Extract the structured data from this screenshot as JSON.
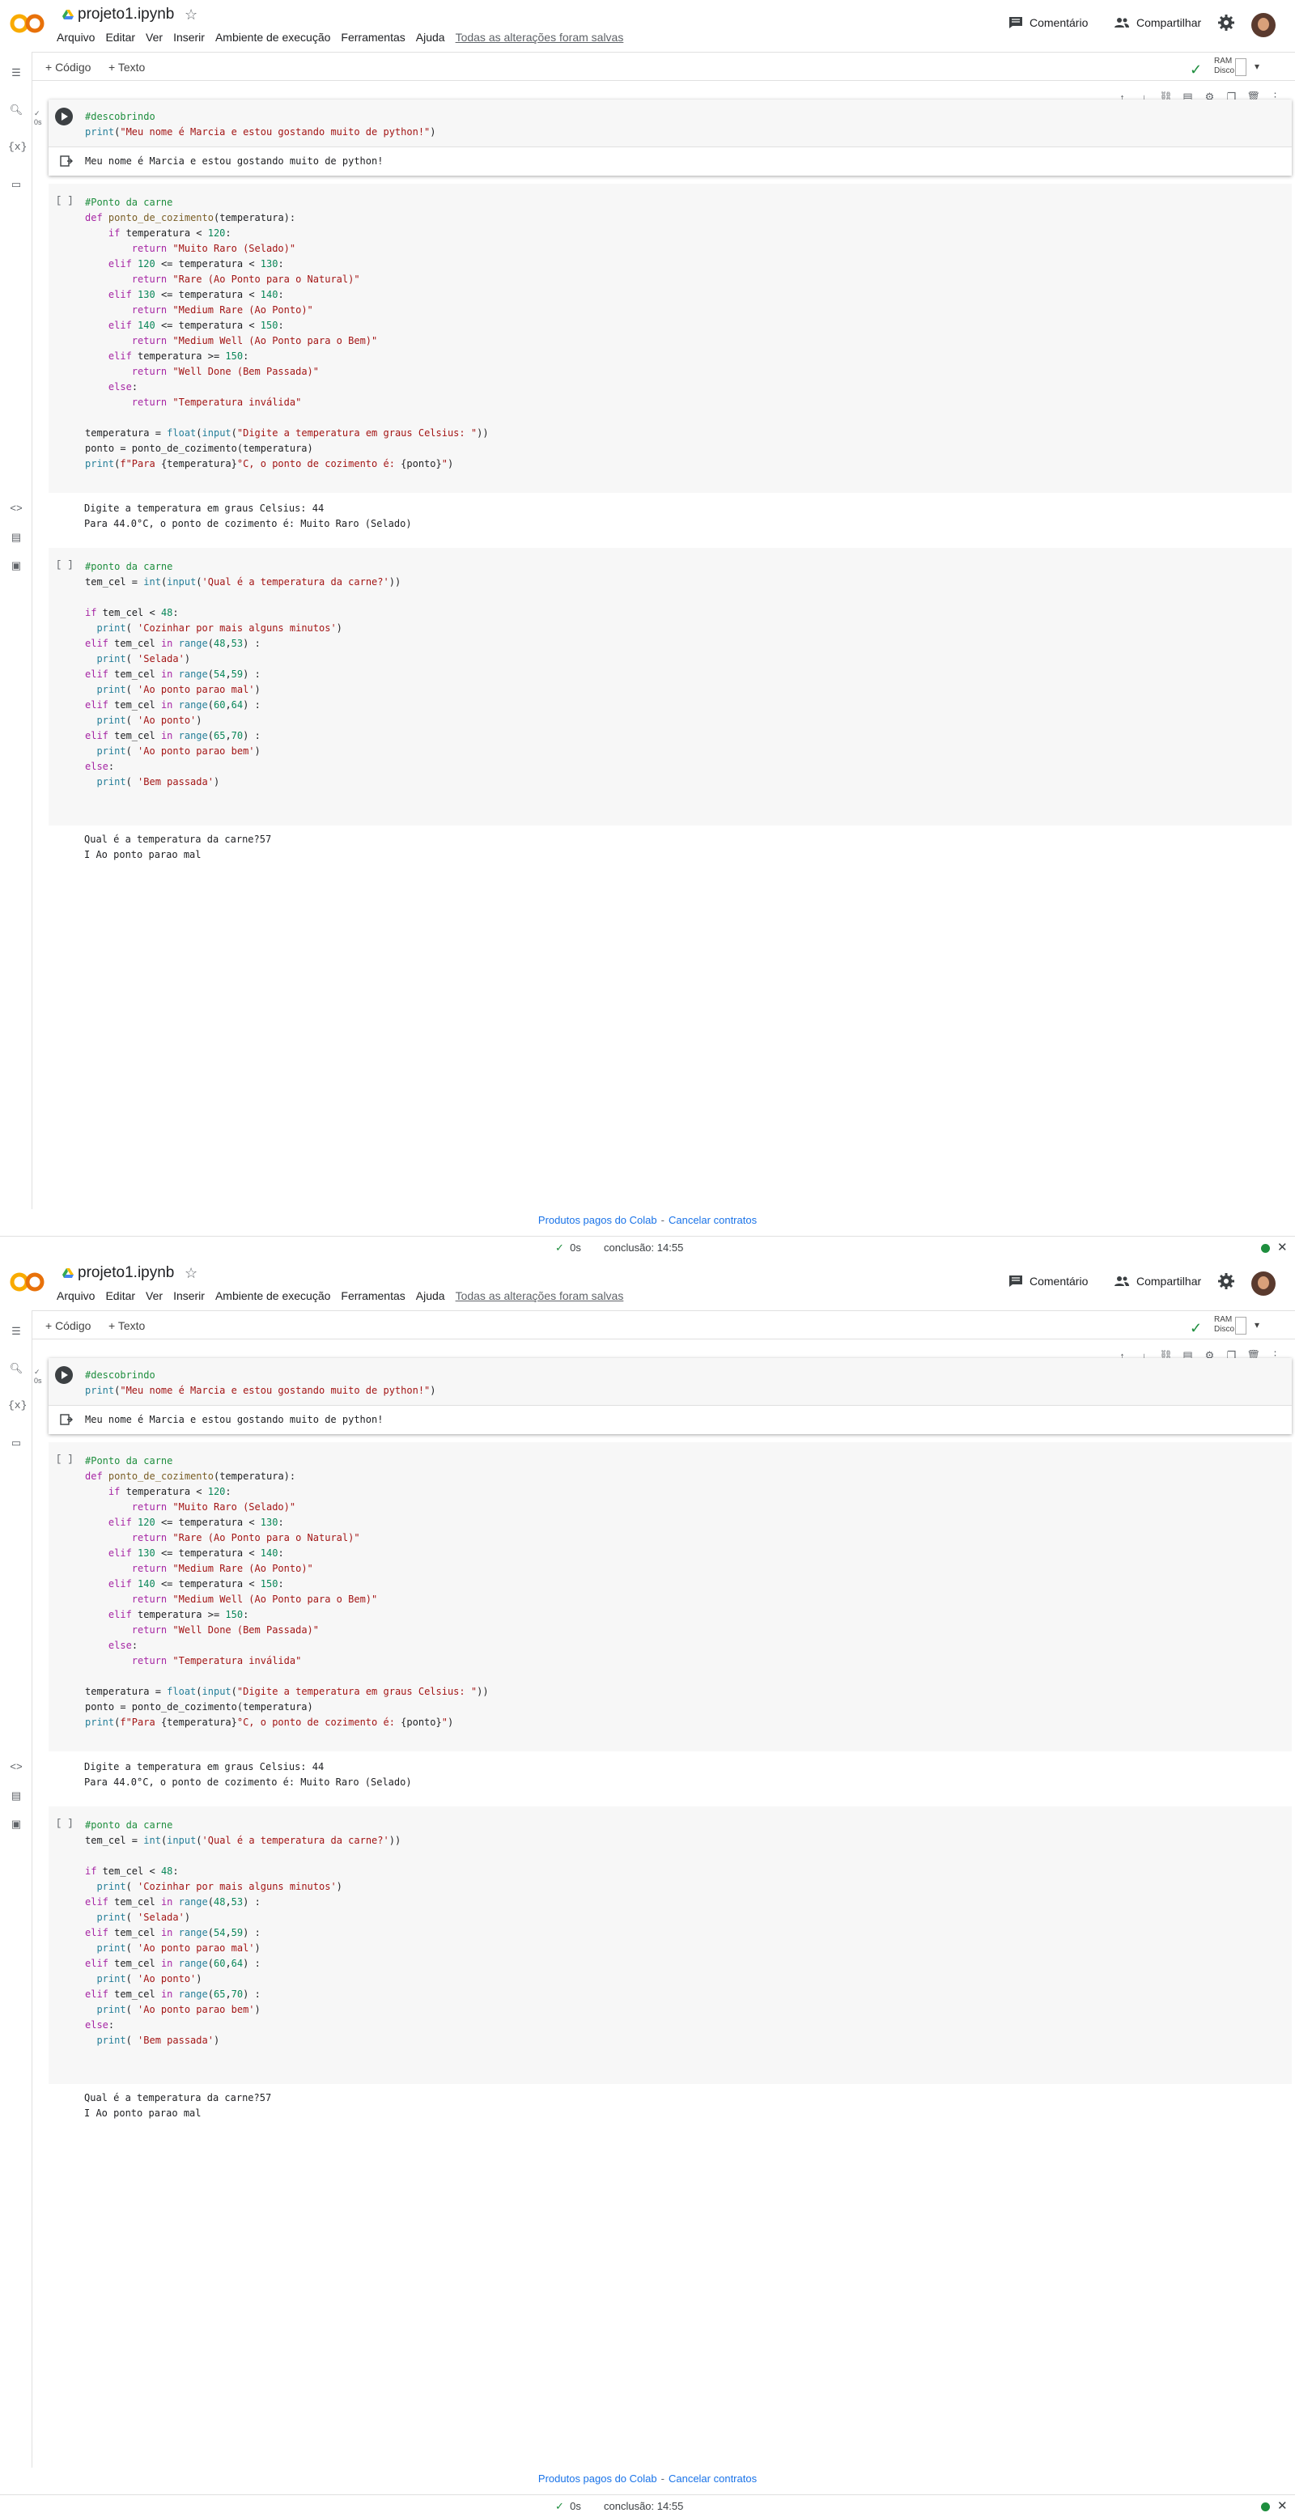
{
  "title": "projeto1.ipynb",
  "menu": [
    "Arquivo",
    "Editar",
    "Ver",
    "Inserir",
    "Ambiente de execução",
    "Ferramentas",
    "Ajuda"
  ],
  "saved": "Todas as alterações foram salvas",
  "comment": "Comentário",
  "share": "Compartilhar",
  "add_code": "+ Código",
  "add_text": "+ Texto",
  "ram": "RAM",
  "disk": "Disco",
  "exec_time_small": "0s",
  "cell1": {
    "code": [
      "#descobrindo",
      "print(\"Meu nome é Marcia e estou gostando muito de python!\")"
    ],
    "output": "Meu nome é Marcia e estou gostando muito de python!"
  },
  "cell2": {
    "code": [
      "#Ponto da carne",
      "def ponto_de_cozimento(temperatura):",
      "    if temperatura < 120:",
      "        return \"Muito Raro (Selado)\"",
      "    elif 120 <= temperatura < 130:",
      "        return \"Rare (Ao Ponto para o Natural)\"",
      "    elif 130 <= temperatura < 140:",
      "        return \"Medium Rare (Ao Ponto)\"",
      "    elif 140 <= temperatura < 150:",
      "        return \"Medium Well (Ao Ponto para o Bem)\"",
      "    elif temperatura >= 150:",
      "        return \"Well Done (Bem Passada)\"",
      "    else:",
      "        return \"Temperatura inválida\"",
      "",
      "temperatura = float(input(\"Digite a temperatura em graus Celsius: \"))",
      "ponto = ponto_de_cozimento(temperatura)",
      "print(f\"Para {temperatura}°C, o ponto de cozimento é: {ponto}\")"
    ],
    "output": [
      "Digite a temperatura em graus Celsius: 44",
      "Para 44.0°C, o ponto de cozimento é: Muito Raro (Selado)"
    ]
  },
  "cell3": {
    "code": [
      "#ponto da carne",
      "tem_cel = int(input('Qual é a temperatura da carne?'))",
      "",
      "if tem_cel < 48:",
      "  print( 'Cozinhar por mais alguns minutos')",
      "elif tem_cel in range(48,53) :",
      "  print( 'Selada')",
      "elif tem_cel in range(54,59) :",
      "  print( 'Ao ponto parao mal')",
      "elif tem_cel in range(60,64) :",
      "  print( 'Ao ponto')",
      "elif tem_cel in range(65,70) :",
      "  print( 'Ao ponto parao bem')",
      "else:",
      "  print( 'Bem passada')"
    ],
    "output": [
      "Qual é a temperatura da carne?57",
      "I Ao ponto parao mal"
    ]
  },
  "footer": {
    "paid": "Produtos pagos do Colab",
    "sep": "-",
    "cancel": "Cancelar contratos"
  },
  "status": {
    "time": "0s",
    "done": "conclusão: 14:55"
  }
}
